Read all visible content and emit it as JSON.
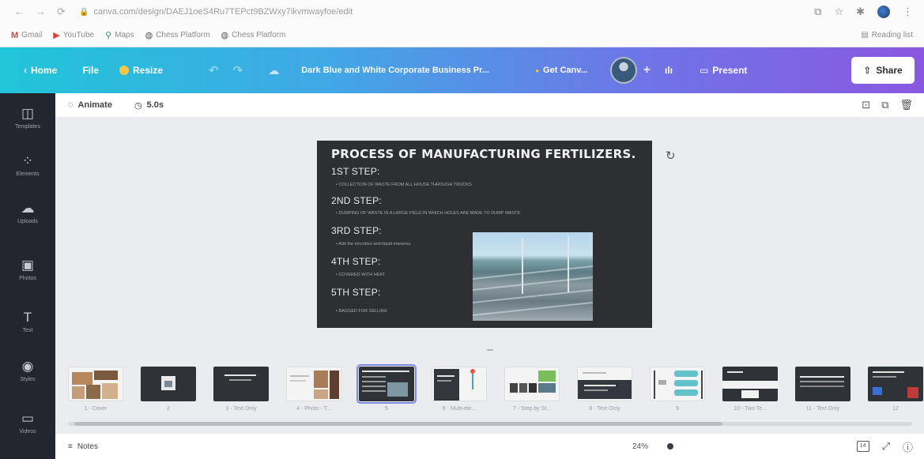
{
  "browser": {
    "url": "canva.com/design/DAEJ1oeS4Ru7TEPct9BZWxy7ikvmwayfoe/edit",
    "bookmarks": [
      {
        "icon": "gmail-icon",
        "label": "Gmail"
      },
      {
        "icon": "youtube-icon",
        "label": "YouTube"
      },
      {
        "icon": "maps-icon",
        "label": "Maps"
      },
      {
        "icon": "globe-icon",
        "label": "Chess Platform"
      },
      {
        "icon": "globe-icon",
        "label": "Chess Platform"
      }
    ],
    "reading_list": "Reading list"
  },
  "topbar": {
    "home": "Home",
    "file": "File",
    "resize": "Resize",
    "doc_title": "Dark Blue and White Corporate Business Pr...",
    "get_canva": "Get Canv...",
    "present": "Present",
    "share": "Share"
  },
  "sidebar": {
    "items": [
      {
        "icon": "templates-icon",
        "label": "Templates"
      },
      {
        "icon": "elements-icon",
        "label": "Elements"
      },
      {
        "icon": "uploads-icon",
        "label": "Uploads"
      },
      {
        "icon": "photos-icon",
        "label": "Photos"
      },
      {
        "icon": "text-icon",
        "label": "Text"
      },
      {
        "icon": "styles-icon",
        "label": "Styles"
      },
      {
        "icon": "videos-icon",
        "label": "Videos"
      }
    ]
  },
  "context_bar": {
    "animate": "Animate",
    "duration": "5.0s"
  },
  "slide": {
    "title": "PROCESS OF MANUFACTURING FERTILIZERS.",
    "steps": [
      {
        "heading": "1ST STEP:",
        "bullet": "•   COLLECTION OF WASTE FROM ALL HOUSE THROUGH TRUCKS."
      },
      {
        "heading": "2ND STEP:",
        "bullet": "•   DUMPING OF WASTE IN A LARGE FIELD IN WHICH HOLES ARE MADE TO DUMP WASTE."
      },
      {
        "heading": "3RD STEP:",
        "bullet": "•   Add the microbes and liquid manures."
      },
      {
        "heading": "4TH STEP:",
        "bullet": "•   COVERED WITH HEAT"
      },
      {
        "heading": "5TH STEP:",
        "bullet": "•   BAGGED FOR SELLING"
      }
    ]
  },
  "thumbnails": [
    {
      "label": "1 - Cover"
    },
    {
      "label": "2"
    },
    {
      "label": "3 - Text Only"
    },
    {
      "label": "4 - Photo - T..."
    },
    {
      "label": "5"
    },
    {
      "label": "6 - Multi-ele..."
    },
    {
      "label": "7 - Step by St..."
    },
    {
      "label": "8 - Text Only"
    },
    {
      "label": "9"
    },
    {
      "label": "10 - Two Te..."
    },
    {
      "label": "11 - Text Only"
    },
    {
      "label": "12"
    }
  ],
  "bottom_bar": {
    "notes": "Notes",
    "zoom": "24%",
    "page_count": "14",
    "help": "?"
  },
  "colors": {
    "topbar_start": "#20c5d8",
    "topbar_end": "#8a58e0",
    "sidebar_bg": "#23262e",
    "slide_bg": "#2e2f32"
  }
}
